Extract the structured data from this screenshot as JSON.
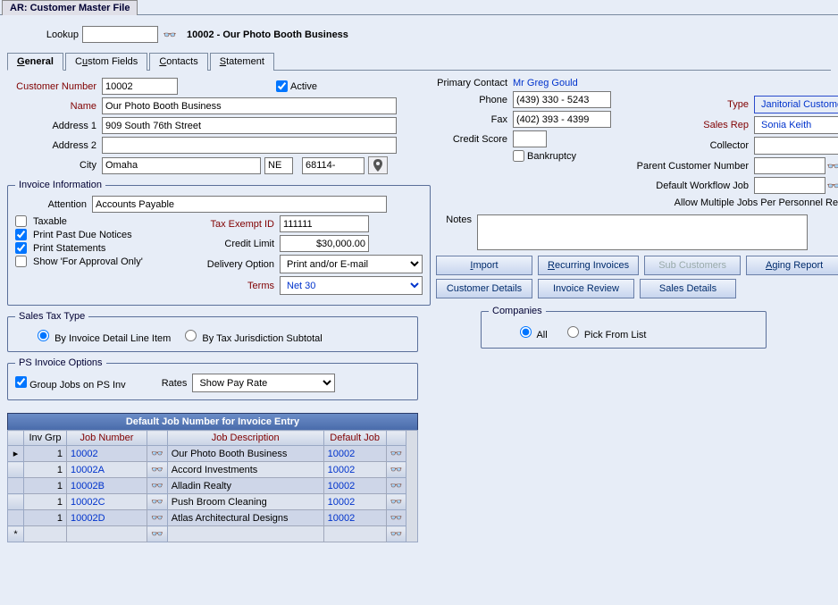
{
  "window_title": "AR: Customer Master File",
  "lookup": {
    "label": "Lookup",
    "value": "",
    "result": "10002 - Our Photo Booth Business"
  },
  "tabs": [
    "General",
    "Custom Fields",
    "Contacts",
    "Statement"
  ],
  "general": {
    "customer_number": {
      "label": "Customer Number",
      "value": "10002"
    },
    "active": {
      "label": "Active",
      "checked": true
    },
    "name": {
      "label": "Name",
      "value": "Our Photo Booth Business"
    },
    "address1": {
      "label": "Address 1",
      "value": "909 South 76th Street"
    },
    "address2": {
      "label": "Address 2",
      "value": ""
    },
    "city": {
      "label": "City",
      "value": "Omaha"
    },
    "state": "NE",
    "zip": "68114-"
  },
  "invoice_info": {
    "legend": "Invoice Information",
    "attention": {
      "label": "Attention",
      "value": "Accounts Payable"
    },
    "taxable": {
      "label": "Taxable",
      "checked": false
    },
    "print_past_due": {
      "label": "Print Past Due Notices",
      "checked": true
    },
    "print_statements": {
      "label": "Print Statements",
      "checked": true
    },
    "show_for_approval": {
      "label": "Show 'For Approval Only'",
      "checked": false
    },
    "tax_exempt_id": {
      "label": "Tax Exempt ID",
      "value": "111111"
    },
    "credit_limit": {
      "label": "Credit Limit",
      "value": "$30,000.00"
    },
    "delivery_option": {
      "label": "Delivery Option",
      "value": "Print and/or E-mail"
    },
    "terms": {
      "label": "Terms",
      "value": "Net 30"
    }
  },
  "sales_tax_type": {
    "legend": "Sales Tax Type",
    "by_line": "By Invoice Detail Line Item",
    "by_jur": "By Tax Jurisdiction Subtotal",
    "selected": "by_line"
  },
  "ps_invoice": {
    "legend": "PS Invoice Options",
    "group_jobs": {
      "label": "Group Jobs on PS Inv",
      "checked": true
    },
    "rates": {
      "label": "Rates",
      "value": "Show Pay Rate"
    }
  },
  "right": {
    "primary_contact": {
      "label": "Primary Contact",
      "value": "Mr Greg Gould"
    },
    "phone": {
      "label": "Phone",
      "value": "(439) 330 - 5243"
    },
    "fax": {
      "label": "Fax",
      "value": "(402) 393 - 4399"
    },
    "credit_score": {
      "label": "Credit Score",
      "value": ""
    },
    "bankruptcy": {
      "label": "Bankruptcy",
      "checked": false
    },
    "type": {
      "label": "Type",
      "value": "Janitorial Customer"
    },
    "sales_rep": {
      "label": "Sales Rep",
      "value": "Sonia Keith"
    },
    "collector": {
      "label": "Collector",
      "value": ""
    },
    "parent_customer": {
      "label": "Parent Customer Number",
      "value": ""
    },
    "default_workflow": {
      "label": "Default Workflow Job",
      "value": ""
    },
    "allow_multiple": {
      "label": "Allow Multiple Jobs Per Personnel Request",
      "checked": false
    },
    "notes": {
      "label": "Notes",
      "value": ""
    }
  },
  "buttons": {
    "import": "Import",
    "recurring": "Recurring Invoices",
    "sub_customers": "Sub Customers",
    "aging": "Aging Report",
    "customer_details": "Customer Details",
    "invoice_review": "Invoice Review",
    "sales_details": "Sales Details"
  },
  "companies": {
    "legend": "Companies",
    "all": "All",
    "pick": "Pick From List",
    "selected": "all"
  },
  "grid": {
    "title": "Default Job Number for Invoice Entry",
    "headers": {
      "inv_grp": "Inv Grp",
      "job_number": "Job Number",
      "job_desc": "Job Description",
      "default_job": "Default Job"
    },
    "rows": [
      {
        "inv_grp": "1",
        "job_number": "10002",
        "job_desc": "Our Photo Booth Business",
        "default_job": "10002"
      },
      {
        "inv_grp": "1",
        "job_number": "10002A",
        "job_desc": "Accord Investments",
        "default_job": "10002"
      },
      {
        "inv_grp": "1",
        "job_number": "10002B",
        "job_desc": "Alladin Realty",
        "default_job": "10002"
      },
      {
        "inv_grp": "1",
        "job_number": "10002C",
        "job_desc": "Push Broom Cleaning",
        "default_job": "10002"
      },
      {
        "inv_grp": "1",
        "job_number": "10002D",
        "job_desc": "Atlas Architectural Designs",
        "default_job": "10002"
      }
    ]
  }
}
